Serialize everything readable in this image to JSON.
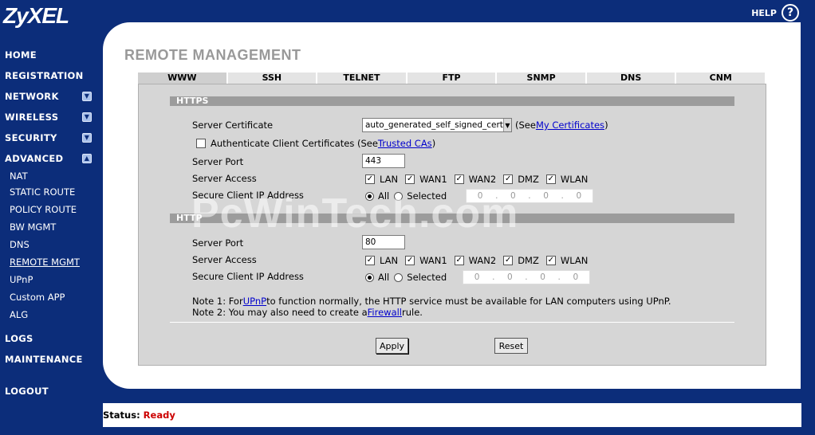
{
  "brand": {
    "logo": "ZyXEL"
  },
  "header": {
    "help_label": "HELP",
    "help_icon": "?"
  },
  "sidebar": {
    "items": [
      {
        "label": "HOME"
      },
      {
        "label": "REGISTRATION"
      },
      {
        "label": "NETWORK",
        "toggle": "▼"
      },
      {
        "label": "WIRELESS",
        "toggle": "▼"
      },
      {
        "label": "SECURITY",
        "toggle": "▼"
      },
      {
        "label": "ADVANCED",
        "toggle": "▲"
      }
    ],
    "sub_items": [
      {
        "label": "NAT"
      },
      {
        "label": "STATIC ROUTE"
      },
      {
        "label": "POLICY ROUTE"
      },
      {
        "label": "BW MGMT"
      },
      {
        "label": "DNS"
      },
      {
        "label": "REMOTE MGMT"
      },
      {
        "label": "UPnP"
      },
      {
        "label": "Custom APP"
      },
      {
        "label": "ALG"
      }
    ],
    "bottom_items": [
      {
        "label": "LOGS"
      },
      {
        "label": "MAINTENANCE"
      },
      {
        "label": "LOGOUT"
      }
    ]
  },
  "page": {
    "title": "REMOTE MANAGEMENT"
  },
  "tabs": [
    "WWW",
    "SSH",
    "TELNET",
    "FTP",
    "SNMP",
    "DNS",
    "CNM"
  ],
  "https": {
    "section_title": "HTTPS",
    "server_certificate_label": "Server Certificate",
    "server_certificate_value": "auto_generated_self_signed_cert",
    "see_prefix": "(See ",
    "my_certificates_link": "My Certificates",
    "see_suffix": ")",
    "auth_client_label": "Authenticate Client Certificates (See ",
    "trusted_cas_link": "Trusted CAs",
    "auth_client_suffix": ")",
    "server_port_label": "Server Port",
    "server_port_value": "443",
    "server_access_label": "Server Access",
    "secure_ip_label": "Secure Client IP Address",
    "all_label": "All",
    "selected_label": "Selected",
    "ip": [
      "0",
      "0",
      "0",
      "0"
    ]
  },
  "http": {
    "section_title": "HTTP",
    "server_port_label": "Server Port",
    "server_port_value": "80",
    "server_access_label": "Server Access",
    "secure_ip_label": "Secure Client IP Address",
    "all_label": "All",
    "selected_label": "Selected",
    "ip": [
      "0",
      "0",
      "0",
      "0"
    ]
  },
  "access_options": [
    "LAN",
    "WAN1",
    "WAN2",
    "DMZ",
    "WLAN"
  ],
  "notes": {
    "note1_prefix": "Note 1: For ",
    "note1_link": "UPnP",
    "note1_suffix": " to function normally, the HTTP service must be available for LAN computers using UPnP.",
    "note2_prefix": "Note 2: You may also need to create a ",
    "note2_link": "Firewall",
    "note2_suffix": " rule."
  },
  "buttons": {
    "apply": "Apply",
    "reset": "Reset"
  },
  "watermark": "PcWinTech.com",
  "status": {
    "label": "Status:",
    "value": "Ready"
  },
  "colors": {
    "sidebar_bg": "#0c2d7a",
    "status_ready": "#cc0000",
    "link": "#0000cc"
  }
}
